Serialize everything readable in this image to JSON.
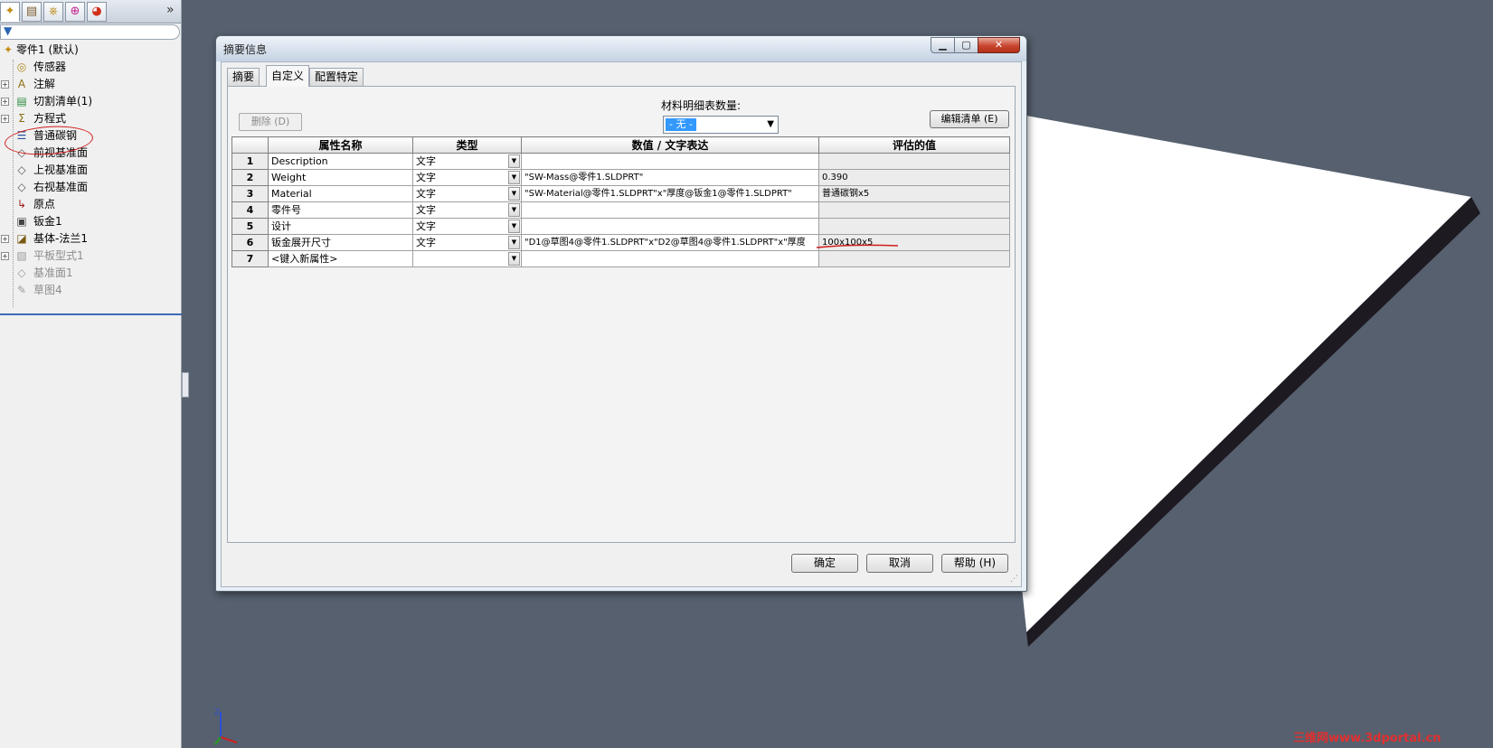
{
  "feature_tree": {
    "panel_tab_icons": [
      "feature-manager-icon",
      "property-manager-icon",
      "configuration-manager-icon",
      "dimxpert-icon",
      "display-manager-icon"
    ],
    "expand_glyph": "»",
    "root": "零件1 (默认)",
    "items": [
      {
        "label": "传感器",
        "icon": "sensor-icon",
        "glyph": "◎",
        "expandable": false,
        "dim": false
      },
      {
        "label": "注解",
        "icon": "annotation-icon",
        "glyph": "A",
        "expandable": true,
        "dim": false
      },
      {
        "label": "切割清单(1)",
        "icon": "cutlist-icon",
        "glyph": "▤",
        "expandable": true,
        "dim": false
      },
      {
        "label": "方程式",
        "icon": "equation-icon",
        "glyph": "Σ",
        "expandable": true,
        "dim": false
      },
      {
        "label": "普通碳钢",
        "icon": "material-icon",
        "glyph": "☰",
        "expandable": false,
        "dim": false
      },
      {
        "label": "前视基准面",
        "icon": "plane-icon",
        "glyph": "◇",
        "expandable": false,
        "dim": false
      },
      {
        "label": "上视基准面",
        "icon": "plane-icon",
        "glyph": "◇",
        "expandable": false,
        "dim": false
      },
      {
        "label": "右视基准面",
        "icon": "plane-icon",
        "glyph": "◇",
        "expandable": false,
        "dim": false
      },
      {
        "label": "原点",
        "icon": "origin-icon",
        "glyph": "↳",
        "expandable": false,
        "dim": false
      },
      {
        "label": "钣金1",
        "icon": "sheetmetal-icon",
        "glyph": "▣",
        "expandable": false,
        "dim": false
      },
      {
        "label": "基体-法兰1",
        "icon": "base-flange-icon",
        "glyph": "◪",
        "expandable": true,
        "dim": false
      },
      {
        "label": "平板型式1",
        "icon": "flat-pattern-icon",
        "glyph": "▧",
        "expandable": true,
        "dim": true
      },
      {
        "label": "基准面1",
        "icon": "plane-icon",
        "glyph": "◇",
        "expandable": false,
        "dim": true
      },
      {
        "label": "草图4",
        "icon": "sketch-icon",
        "glyph": "✎",
        "expandable": false,
        "dim": true
      }
    ]
  },
  "dialog": {
    "title": "摘要信息",
    "tabs": [
      "摘要",
      "自定义",
      "配置特定"
    ],
    "active_tab": "自定义",
    "delete_button": "删除 (D)",
    "bom_quantity_label": "材料明细表数量:",
    "bom_quantity_value": "- 无 -",
    "edit_list_button": "编辑清单 (E)",
    "columns": [
      "",
      "属性名称",
      "类型",
      "数值 / 文字表达",
      "评估的值"
    ],
    "rows": [
      {
        "num": "1",
        "name": "Description",
        "type": "文字",
        "expression": "",
        "evaluated": ""
      },
      {
        "num": "2",
        "name": "Weight",
        "type": "文字",
        "expression": "\"SW-Mass@零件1.SLDPRT\"",
        "evaluated": "0.390"
      },
      {
        "num": "3",
        "name": "Material",
        "type": "文字",
        "expression": "\"SW-Material@零件1.SLDPRT\"x\"厚度@钣金1@零件1.SLDPRT\"",
        "evaluated": "普通碳钢x5"
      },
      {
        "num": "4",
        "name": "零件号",
        "type": "文字",
        "expression": "",
        "evaluated": ""
      },
      {
        "num": "5",
        "name": "设计",
        "type": "文字",
        "expression": "",
        "evaluated": ""
      },
      {
        "num": "6",
        "name": "钣金展开尺寸",
        "type": "文字",
        "expression": "\"D1@草图4@零件1.SLDPRT\"x\"D2@草图4@零件1.SLDPRT\"x\"厚度",
        "evaluated": "100x100x5"
      },
      {
        "num": "7",
        "name": "<键入新属性>",
        "type": "",
        "expression": "",
        "evaluated": ""
      }
    ],
    "ok_button": "确定",
    "cancel_button": "取消",
    "help_button": "帮助 (H)"
  },
  "watermark": "三维网www.3dportal.cn",
  "colors": {
    "viewport_bg": "#56606e",
    "plate_top": "#ffffff",
    "plate_side": "#1e1a22",
    "annotation_red": "#d01c1c",
    "selection_blue": "#3399ff"
  }
}
